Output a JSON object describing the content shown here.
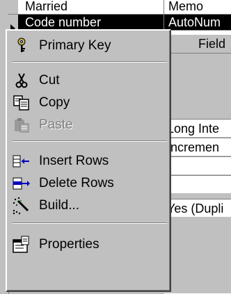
{
  "table": {
    "rows": [
      {
        "name": "Married",
        "type": "Memo"
      },
      {
        "name": "Code number",
        "type": "AutoNum"
      }
    ],
    "field_header": "Field",
    "properties": {
      "field_size": "Long Inte",
      "new_values": "Incremen",
      "indexed": "Yes (Dupli"
    }
  },
  "menu": {
    "items": [
      {
        "label": "Primary Key",
        "icon": "key-icon",
        "enabled": true
      },
      {
        "label": "Cut",
        "icon": "scissors-icon",
        "enabled": true
      },
      {
        "label": "Copy",
        "icon": "copy-icon",
        "enabled": true
      },
      {
        "label": "Paste",
        "icon": "paste-icon",
        "enabled": false
      },
      {
        "label": "Insert Rows",
        "icon": "insert-rows-icon",
        "enabled": true
      },
      {
        "label": "Delete Rows",
        "icon": "delete-rows-icon",
        "enabled": true
      },
      {
        "label": "Build...",
        "icon": "build-wand-icon",
        "enabled": true
      },
      {
        "label": "Properties",
        "icon": "properties-icon",
        "enabled": true
      }
    ]
  }
}
